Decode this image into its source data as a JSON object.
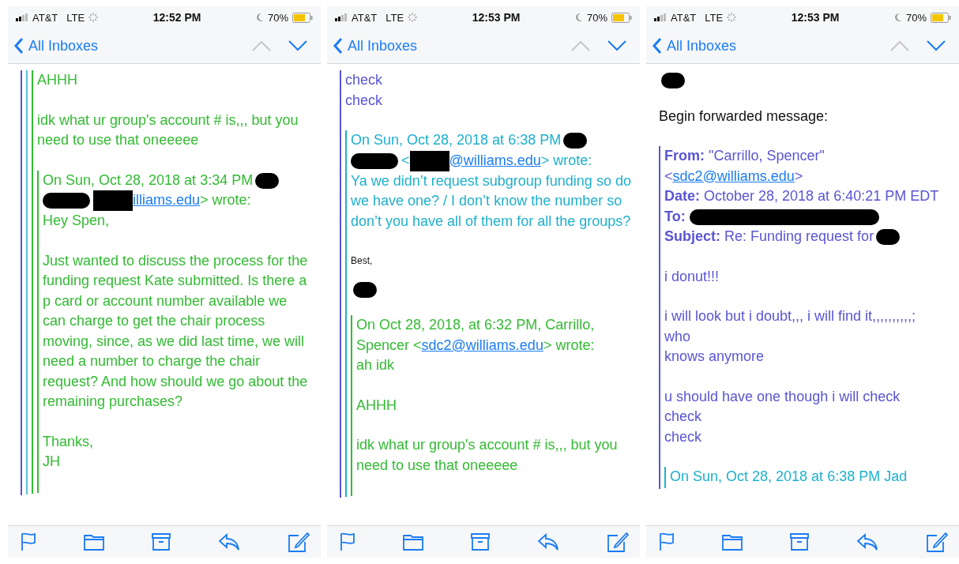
{
  "phones": [
    {
      "status": {
        "carrier": "AT&T",
        "network": "LTE",
        "time": "12:52 PM",
        "battery": "70%"
      },
      "nav": {
        "back": "All Inboxes",
        "previous_disabled": true,
        "next_disabled": false
      },
      "body": [
        {
          "kind": "quote",
          "color": "#5a55d2",
          "children": [
            {
              "kind": "quote",
              "color": "#5bc0de",
              "children": [
                {
                  "kind": "quote",
                  "color": "#33bb33",
                  "children": [
                    {
                      "kind": "para",
                      "text": "AHHH"
                    },
                    {
                      "kind": "para",
                      "text": "idk what ur group's account # is,,, but you need to use that oneeeee"
                    },
                    {
                      "kind": "quote",
                      "color": "#33bb33",
                      "children": [
                        {
                          "kind": "header",
                          "segments": [
                            {
                              "kind": "text",
                              "text": "On Sun, Oct 28, 2018 at 3:34 PM"
                            },
                            {
                              "kind": "blob"
                            },
                            {
                              "kind": "streak"
                            },
                            {
                              "kind": "box"
                            },
                            {
                              "kind": "link",
                              "text": "illiams.edu"
                            },
                            {
                              "kind": "text",
                              "text": "> wrote:"
                            }
                          ]
                        },
                        {
                          "kind": "para",
                          "text": "Hey Spen,"
                        },
                        {
                          "kind": "para",
                          "text": "Just wanted to discuss the process for the funding request Kate submitted. Is there a p card or account number available we can charge to get the chair process moving, since, as we did last time, we will need a number to charge the chair request? And how should we go about the remaining purchases?"
                        },
                        {
                          "kind": "para",
                          "text": "Thanks,\nJH"
                        }
                      ]
                    }
                  ]
                }
              ]
            }
          ]
        }
      ]
    },
    {
      "status": {
        "carrier": "AT&T",
        "network": "LTE",
        "time": "12:53 PM",
        "battery": "70%"
      },
      "nav": {
        "back": "All Inboxes",
        "previous_disabled": true,
        "next_disabled": false
      },
      "body": [
        {
          "kind": "quote",
          "color": "#5a55d2",
          "children": [
            {
              "kind": "para",
              "text": "check\ncheck"
            },
            {
              "kind": "quote",
              "color": "#1fb0cc",
              "children": [
                {
                  "kind": "header",
                  "segments": [
                    {
                      "kind": "text",
                      "text": "On Sun, Oct 28, 2018 at 6:38 PM"
                    },
                    {
                      "kind": "blob"
                    },
                    {
                      "kind": "streak"
                    },
                    {
                      "kind": "text",
                      "text": "<"
                    },
                    {
                      "kind": "box"
                    },
                    {
                      "kind": "link",
                      "text": "@williams.edu"
                    },
                    {
                      "kind": "text",
                      "text": "> wrote:"
                    }
                  ]
                },
                {
                  "kind": "para",
                  "text": "Ya we didn’t request subgroup funding so do we have one? / I don’t know the number so don’t you have all of them for all the groups?"
                },
                {
                  "kind": "signature",
                  "text": "Best,"
                },
                {
                  "kind": "blob"
                },
                {
                  "kind": "quote",
                  "color": "#33bb33",
                  "children": [
                    {
                      "kind": "header",
                      "segments": [
                        {
                          "kind": "text",
                          "text": "On Oct 28, 2018, at 6:32 PM, Carrillo, Spencer <"
                        },
                        {
                          "kind": "link",
                          "text": "sdc2@williams.edu"
                        },
                        {
                          "kind": "text",
                          "text": "> wrote:"
                        }
                      ]
                    },
                    {
                      "kind": "para",
                      "text": "ah idk"
                    },
                    {
                      "kind": "para",
                      "text": "AHHH"
                    },
                    {
                      "kind": "para",
                      "text": "idk what ur group's account # is,,, but you need to use that oneeeee"
                    }
                  ]
                }
              ]
            }
          ]
        }
      ]
    },
    {
      "status": {
        "carrier": "AT&T",
        "network": "LTE",
        "time": "12:53 PM",
        "battery": "70%"
      },
      "nav": {
        "back": "All Inboxes",
        "previous_disabled": true,
        "next_disabled": false
      },
      "body": [
        {
          "kind": "blob"
        },
        {
          "kind": "para",
          "text": "Begin forwarded message:"
        },
        {
          "kind": "quote",
          "color": "#5a55d2",
          "children": [
            {
              "kind": "fields",
              "rows": [
                {
                  "label": "From:",
                  "segments": [
                    {
                      "kind": "text",
                      "text": "\"Carrillo, Spencer\" <"
                    },
                    {
                      "kind": "link",
                      "text": "sdc2@williams.edu"
                    },
                    {
                      "kind": "text",
                      "text": ">"
                    }
                  ]
                },
                {
                  "label": "Date:",
                  "segments": [
                    {
                      "kind": "text",
                      "text": "October 28, 2018 at 6:40:21 PM EDT"
                    }
                  ]
                },
                {
                  "label": "To:",
                  "segments": [
                    {
                      "kind": "streak"
                    }
                  ]
                },
                {
                  "label": "Subject:",
                  "segments": [
                    {
                      "kind": "text",
                      "text": "Re: Funding request for"
                    },
                    {
                      "kind": "blob"
                    }
                  ]
                }
              ]
            },
            {
              "kind": "para",
              "text": "i donut!!!"
            },
            {
              "kind": "para",
              "text": "i will look but i doubt,,, i will find it,,,,,,,,,,;\nwho\nknows anymore"
            },
            {
              "kind": "para",
              "text": "u should have one though i will check\ncheck\ncheck"
            },
            {
              "kind": "quote",
              "color": "#1fb0cc",
              "children": [
                {
                  "kind": "header",
                  "segments": [
                    {
                      "kind": "text",
                      "text": "On Sun, Oct 28, 2018 at 6:38 PM Jad"
                    }
                  ]
                }
              ]
            }
          ]
        }
      ]
    }
  ]
}
